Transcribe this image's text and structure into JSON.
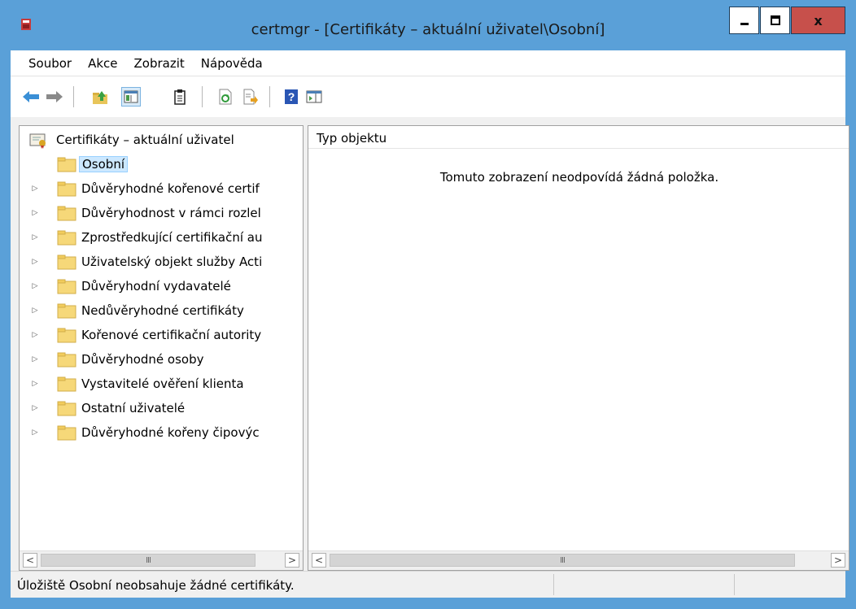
{
  "window": {
    "title": "certmgr - [Certifikáty – aktuální uživatel\\Osobní]",
    "close_glyph": "x",
    "accent_color": "#5aa0d8",
    "close_color": "#c7504b"
  },
  "menu": {
    "items": [
      {
        "label": "Soubor"
      },
      {
        "label": "Akce"
      },
      {
        "label": "Zobrazit"
      },
      {
        "label": "Nápověda"
      }
    ]
  },
  "toolbar": {
    "buttons": [
      {
        "icon": "back-arrow-icon"
      },
      {
        "icon": "forward-arrow-icon"
      },
      {
        "icon": "up-folder-icon"
      },
      {
        "icon": "console-tree-icon"
      },
      {
        "icon": "clipboard-icon"
      },
      {
        "icon": "refresh-icon"
      },
      {
        "icon": "export-list-icon"
      },
      {
        "icon": "help-icon"
      },
      {
        "icon": "action-pane-icon"
      }
    ]
  },
  "tree": {
    "root": {
      "label": "Certifikáty – aktuální uživatel",
      "icon": "certificate-store-icon"
    },
    "items": [
      {
        "label": "Osobní",
        "selected": true,
        "expandable": false
      },
      {
        "label": "Důvěryhodné kořenové certif",
        "expandable": true
      },
      {
        "label": "Důvěryhodnost v rámci rozlel",
        "expandable": true
      },
      {
        "label": "Zprostředkující certifikační au",
        "expandable": true
      },
      {
        "label": "Uživatelský objekt služby Acti",
        "expandable": true
      },
      {
        "label": "Důvěryhodní vydavatelé",
        "expandable": true
      },
      {
        "label": "Nedůvěryhodné certifikáty",
        "expandable": true
      },
      {
        "label": "Kořenové certifikační autority",
        "expandable": true
      },
      {
        "label": "Důvěryhodné osoby",
        "expandable": true
      },
      {
        "label": "Vystavitelé ověření klienta",
        "expandable": true
      },
      {
        "label": "Ostatní uživatelé",
        "expandable": true
      },
      {
        "label": "Důvěryhodné kořeny čipovýc",
        "expandable": true
      }
    ]
  },
  "list": {
    "column_header": "Typ objektu",
    "empty_message": "Tomuto zobrazení neodpovídá žádná položka."
  },
  "scroll": {
    "left_glyph": "<",
    "right_glyph": ">",
    "thumb_glyph": "III"
  },
  "status": {
    "text": "Úložiště Osobní neobsahuje žádné certifikáty."
  }
}
